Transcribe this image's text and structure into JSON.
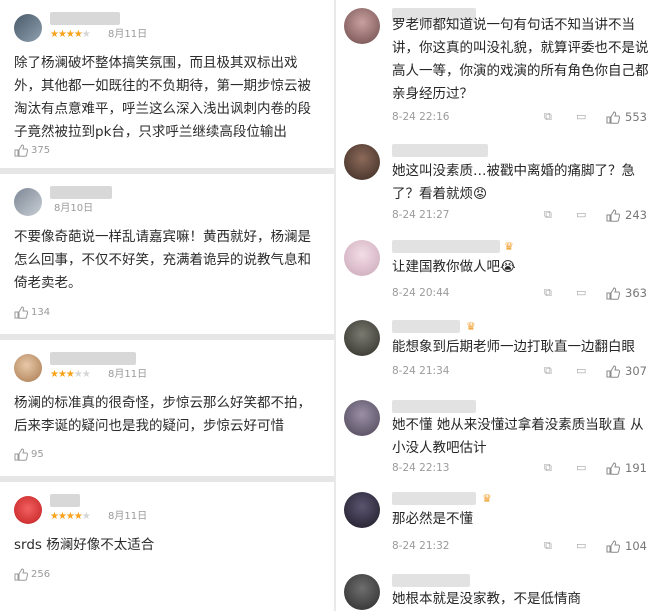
{
  "left_reviews": [
    {
      "date": "8月11日",
      "stars_on": "★★★★",
      "stars_off": "★",
      "text": "除了杨澜破坏整体搞笑氛围，而且极其双标出戏外，其他都一如既往的不负期待，第一期步惊云被淘汰有点意难平，呼兰这么深入浅出讽刺内卷的段子竟然被拉到pk台，只求呼兰继续高段位输出",
      "likes": "375"
    },
    {
      "date": "8月10日",
      "stars_on": "",
      "stars_off": "",
      "text": "不要像奇葩说一样乱请嘉宾嘛！黄西就好，杨澜是怎么回事，不仅不好笑，充满着诡异的说教气息和倚老卖老。",
      "likes": "134"
    },
    {
      "date": "8月11日",
      "stars_on": "★★★",
      "stars_off": "★★",
      "text": "杨澜的标准真的很奇怪，步惊云那么好笑都不拍，后来李诞的疑问也是我的疑问，步惊云好可惜",
      "likes": "95"
    },
    {
      "date": "8月11日",
      "stars_on": "★★★★",
      "stars_off": "★",
      "text": "srds 杨澜好像不太适合",
      "likes": "256"
    }
  ],
  "right_comments": [
    {
      "text": "罗老师都知道说一句有句话不知当讲不当讲，你这真的叫没礼貌，就算评委也不是说高人一等，你演的戏演的所有角色你自己都亲身经历过？",
      "time": "8-24 22:16",
      "likes": "553",
      "crown": ""
    },
    {
      "text": "她这叫没素质…被戳中离婚的痛脚了？急了？看着就烦😡",
      "time": "8-24 21:27",
      "likes": "243",
      "crown": ""
    },
    {
      "text": "让建国教你做人吧😭",
      "time": "8-24 20:44",
      "likes": "363",
      "crown": "♛"
    },
    {
      "text": "能想象到后期老师一边打耿直一边翻白眼",
      "time": "8-24 21:34",
      "likes": "307",
      "crown": "♛"
    },
    {
      "text": "她不懂 她从来没懂过拿着没素质当耿直 从小没人教吧估计",
      "time": "8-24 22:13",
      "likes": "191",
      "crown": ""
    },
    {
      "text": "那必然是不懂",
      "time": "8-24 21:32",
      "likes": "104",
      "crown": "♛"
    },
    {
      "text": "她根本就是没家教，不是低情商",
      "time": "",
      "likes": "",
      "crown": ""
    }
  ],
  "icons": {
    "like": "thumbs-up-icon",
    "share": "share-icon",
    "comment": "comment-icon"
  },
  "colors": {
    "star": "#f7a21b",
    "star_off": "#d6d6d6"
  }
}
